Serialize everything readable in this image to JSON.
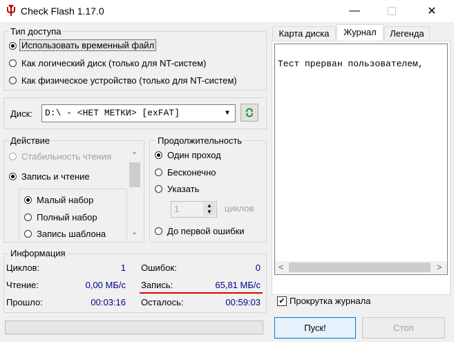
{
  "window": {
    "title": "Check Flash 1.17.0",
    "colors": {
      "title_icon": "#c00000",
      "accent_blue": "#00008b",
      "underline_red": "#e00000",
      "green_icon": "#2a8a2a"
    }
  },
  "access": {
    "group_title": "Тип доступа",
    "options": [
      "Использовать временный файл",
      "Как логический диск (только для NT-систем)",
      "Как физическое устройство (только для NT-систем)"
    ],
    "selected_index": 0
  },
  "disk": {
    "label": "Диск:",
    "value": "D:\\ - <НЕТ МЕТКИ> [exFAT]",
    "refresh_icon": "refresh-icon"
  },
  "action": {
    "group_title": "Действие",
    "options": [
      "Стабильность чтения",
      "Запись и чтение"
    ],
    "sub_options": [
      "Малый набор",
      "Полный набор",
      "Запись шаблона"
    ]
  },
  "duration": {
    "group_title": "Продолжительность",
    "options": [
      "Один проход",
      "Бесконечно",
      "Указать",
      "До первой ошибки"
    ],
    "count_value": "1",
    "count_unit": "циклов"
  },
  "info": {
    "group_title": "Информация",
    "cycles_label": "Циклов:",
    "cycles_value": "1",
    "errors_label": "Ошибок:",
    "errors_value": "0",
    "read_label": "Чтение:",
    "read_value": "0,00 МБ/с",
    "write_label": "Запись:",
    "write_value": "65,81 МБ/с",
    "elapsed_label": "Прошло:",
    "elapsed_value": "00:03:16",
    "remaining_label": "Осталось:",
    "remaining_value": "00:59:03"
  },
  "tabs": [
    "Карта диска",
    "Журнал",
    "Легенда"
  ],
  "log": {
    "text": "Тест прерван пользователем,",
    "scroll_label": "Прокрутка журнала"
  },
  "buttons": {
    "start": "Пуск!",
    "stop": "Стоп"
  }
}
